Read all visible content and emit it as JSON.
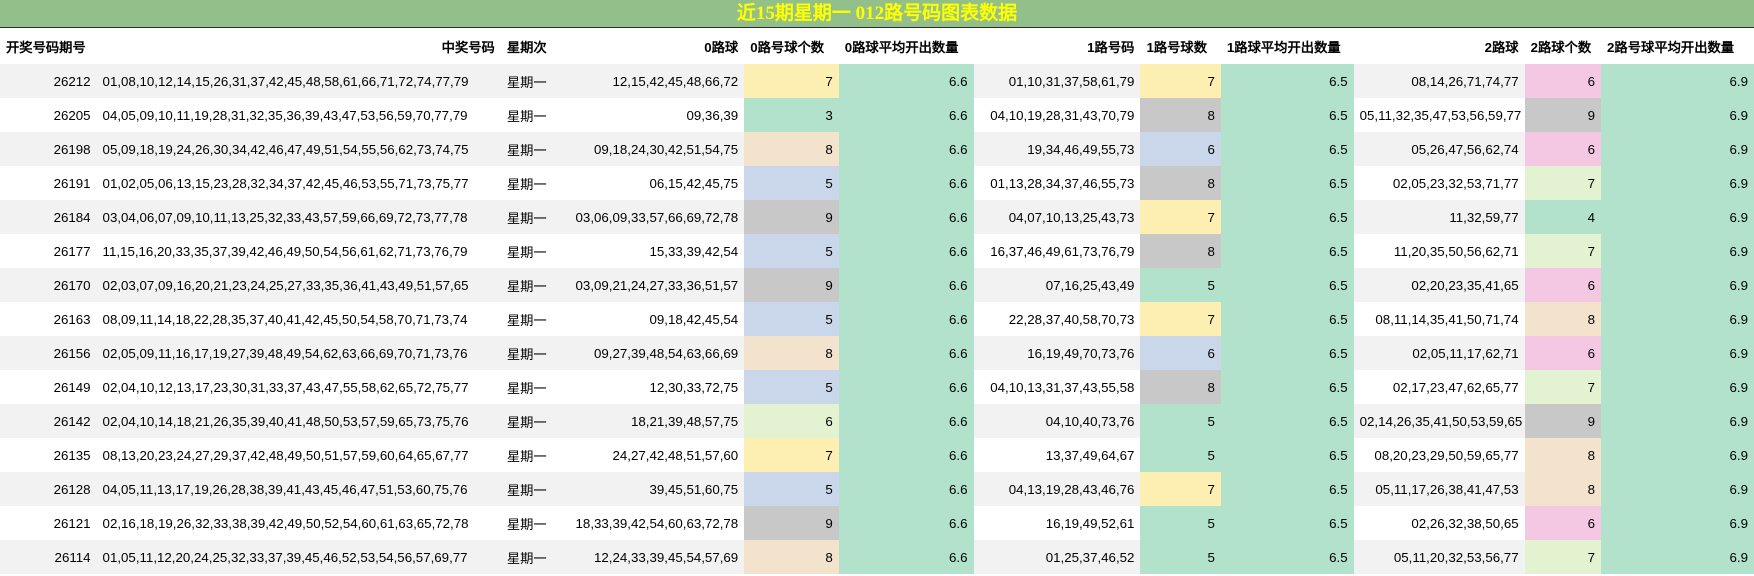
{
  "title": "近15期星期一 012路号码图表数据",
  "headers": [
    "开奖号码期号",
    "中奖号码",
    "星期次",
    "0路球",
    "0路号球个数",
    "0路球平均开出数量",
    "1路号码",
    "1路号球数",
    "1路球平均开出数量",
    "2路球",
    "2路球个数",
    "2路号球平均开出数量"
  ],
  "count_colors": {
    "3": "#b2e1cc",
    "4": "#b2e1cc",
    "5": "#cad6ea",
    "6": "#e3f2d1",
    "7": "#fdefb2",
    "8": "#f4e3cc",
    "9": "#c8c8c8"
  },
  "count_colors_col3": {
    "5": "#b2e1cc",
    "6": "#cad6ea",
    "7": "#fdefb2",
    "8": "#c8c8c8"
  },
  "count_colors_col4": {
    "4": "#b2e1cc",
    "6": "#f4c8e3",
    "7": "#e3f2d1",
    "8": "#f4e3cc",
    "9": "#c8c8c8"
  },
  "rows": [
    [
      "26212",
      "01,08,10,12,14,15,26,31,37,42,45,48,58,61,66,71,72,74,77,79",
      "星期一",
      "12,15,42,45,48,66,72",
      "7",
      "6.6",
      "01,10,31,37,58,61,79",
      "7",
      "6.5",
      "08,14,26,71,74,77",
      "6",
      "6.9"
    ],
    [
      "26205",
      "04,05,09,10,11,19,28,31,32,35,36,39,43,47,53,56,59,70,77,79",
      "星期一",
      "09,36,39",
      "3",
      "6.6",
      "04,10,19,28,31,43,70,79",
      "8",
      "6.5",
      "05,11,32,35,47,53,56,59,77",
      "9",
      "6.9"
    ],
    [
      "26198",
      "05,09,18,19,24,26,30,34,42,46,47,49,51,54,55,56,62,73,74,75",
      "星期一",
      "09,18,24,30,42,51,54,75",
      "8",
      "6.6",
      "19,34,46,49,55,73",
      "6",
      "6.5",
      "05,26,47,56,62,74",
      "6",
      "6.9"
    ],
    [
      "26191",
      "01,02,05,06,13,15,23,28,32,34,37,42,45,46,53,55,71,73,75,77",
      "星期一",
      "06,15,42,45,75",
      "5",
      "6.6",
      "01,13,28,34,37,46,55,73",
      "8",
      "6.5",
      "02,05,23,32,53,71,77",
      "7",
      "6.9"
    ],
    [
      "26184",
      "03,04,06,07,09,10,11,13,25,32,33,43,57,59,66,69,72,73,77,78",
      "星期一",
      "03,06,09,33,57,66,69,72,78",
      "9",
      "6.6",
      "04,07,10,13,25,43,73",
      "7",
      "6.5",
      "11,32,59,77",
      "4",
      "6.9"
    ],
    [
      "26177",
      "11,15,16,20,33,35,37,39,42,46,49,50,54,56,61,62,71,73,76,79",
      "星期一",
      "15,33,39,42,54",
      "5",
      "6.6",
      "16,37,46,49,61,73,76,79",
      "8",
      "6.5",
      "11,20,35,50,56,62,71",
      "7",
      "6.9"
    ],
    [
      "26170",
      "02,03,07,09,16,20,21,23,24,25,27,33,35,36,41,43,49,51,57,65",
      "星期一",
      "03,09,21,24,27,33,36,51,57",
      "9",
      "6.6",
      "07,16,25,43,49",
      "5",
      "6.5",
      "02,20,23,35,41,65",
      "6",
      "6.9"
    ],
    [
      "26163",
      "08,09,11,14,18,22,28,35,37,40,41,42,45,50,54,58,70,71,73,74",
      "星期一",
      "09,18,42,45,54",
      "5",
      "6.6",
      "22,28,37,40,58,70,73",
      "7",
      "6.5",
      "08,11,14,35,41,50,71,74",
      "8",
      "6.9"
    ],
    [
      "26156",
      "02,05,09,11,16,17,19,27,39,48,49,54,62,63,66,69,70,71,73,76",
      "星期一",
      "09,27,39,48,54,63,66,69",
      "8",
      "6.6",
      "16,19,49,70,73,76",
      "6",
      "6.5",
      "02,05,11,17,62,71",
      "6",
      "6.9"
    ],
    [
      "26149",
      "02,04,10,12,13,17,23,30,31,33,37,43,47,55,58,62,65,72,75,77",
      "星期一",
      "12,30,33,72,75",
      "5",
      "6.6",
      "04,10,13,31,37,43,55,58",
      "8",
      "6.5",
      "02,17,23,47,62,65,77",
      "7",
      "6.9"
    ],
    [
      "26142",
      "02,04,10,14,18,21,26,35,39,40,41,48,50,53,57,59,65,73,75,76",
      "星期一",
      "18,21,39,48,57,75",
      "6",
      "6.6",
      "04,10,40,73,76",
      "5",
      "6.5",
      "02,14,26,35,41,50,53,59,65",
      "9",
      "6.9"
    ],
    [
      "26135",
      "08,13,20,23,24,27,29,37,42,48,49,50,51,57,59,60,64,65,67,77",
      "星期一",
      "24,27,42,48,51,57,60",
      "7",
      "6.6",
      "13,37,49,64,67",
      "5",
      "6.5",
      "08,20,23,29,50,59,65,77",
      "8",
      "6.9"
    ],
    [
      "26128",
      "04,05,11,13,17,19,26,28,38,39,41,43,45,46,47,51,53,60,75,76",
      "星期一",
      "39,45,51,60,75",
      "5",
      "6.6",
      "04,13,19,28,43,46,76",
      "7",
      "6.5",
      "05,11,17,26,38,41,47,53",
      "8",
      "6.9"
    ],
    [
      "26121",
      "02,16,18,19,26,32,33,38,39,42,49,50,52,54,60,61,63,65,72,78",
      "星期一",
      "18,33,39,42,54,60,63,72,78",
      "9",
      "6.6",
      "16,19,49,52,61",
      "5",
      "6.5",
      "02,26,32,38,50,65",
      "6",
      "6.9"
    ],
    [
      "26114",
      "01,05,11,12,20,24,25,32,33,37,39,45,46,52,53,54,56,57,69,77",
      "星期一",
      "12,24,33,39,45,54,57,69",
      "8",
      "6.6",
      "01,25,37,46,52",
      "5",
      "6.5",
      "05,11,20,32,53,56,77",
      "7",
      "6.9"
    ]
  ]
}
